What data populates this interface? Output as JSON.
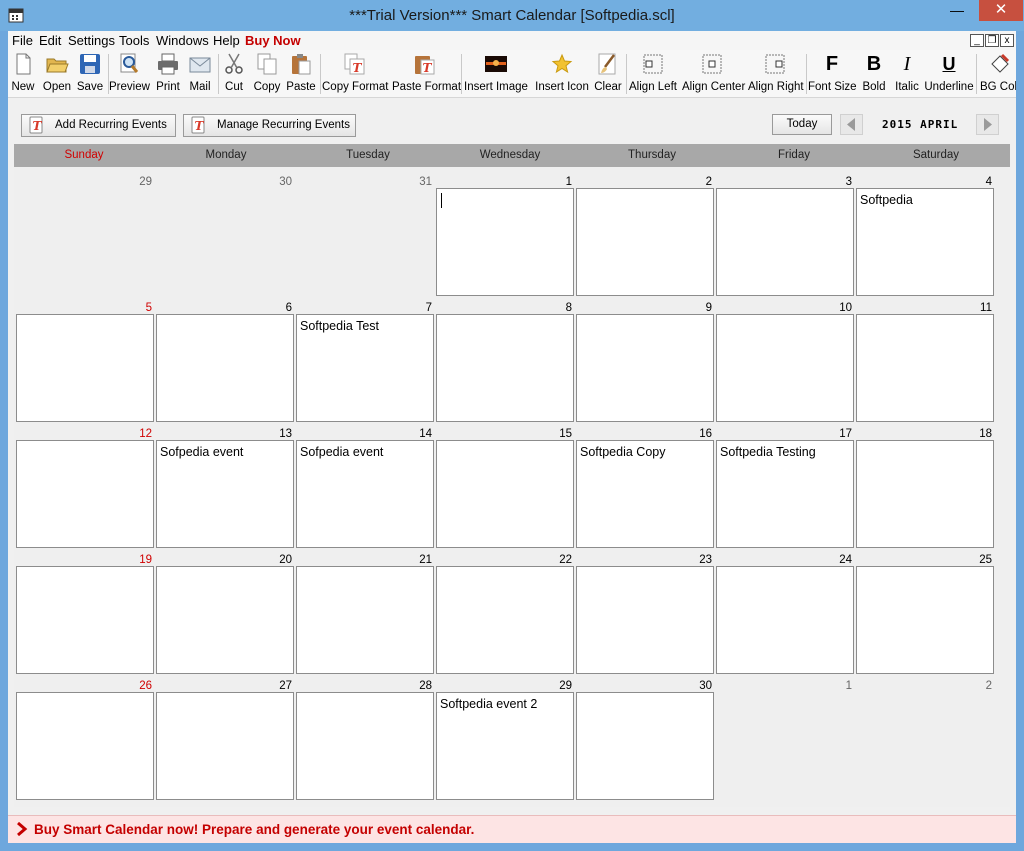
{
  "window": {
    "title": "***Trial Version*** Smart Calendar [Softpedia.scl]",
    "minimize_glyph": "—",
    "maximize_glyph": "☐",
    "close_glyph": "✕"
  },
  "menu": {
    "items": [
      "File",
      "Edit",
      "Settings",
      "Tools",
      "Windows",
      "Help",
      "Buy Now"
    ],
    "mdi_minimize": "_",
    "mdi_restore": "❐",
    "mdi_close": "x"
  },
  "toolbar": {
    "buttons": [
      {
        "label": "New",
        "icon": "new-file-icon"
      },
      {
        "label": "Open",
        "icon": "open-folder-icon"
      },
      {
        "label": "Save",
        "icon": "save-disk-icon"
      },
      {
        "label": "Preview",
        "icon": "preview-magnifier-icon"
      },
      {
        "label": "Print",
        "icon": "printer-icon"
      },
      {
        "label": "Mail",
        "icon": "mail-icon"
      },
      {
        "label": "Cut",
        "icon": "scissors-icon"
      },
      {
        "label": "Copy",
        "icon": "copy-icon"
      },
      {
        "label": "Paste",
        "icon": "paste-clipboard-icon"
      },
      {
        "label": "Copy Format",
        "icon": "copy-format-icon"
      },
      {
        "label": "Paste Format",
        "icon": "paste-format-icon"
      },
      {
        "label": "Insert Image",
        "icon": "insert-image-icon"
      },
      {
        "label": "Insert Icon",
        "icon": "insert-icon-star-icon"
      },
      {
        "label": "Clear",
        "icon": "clear-brush-icon"
      },
      {
        "label": "Align Left",
        "icon": "align-left-icon"
      },
      {
        "label": "Align Center",
        "icon": "align-center-icon"
      },
      {
        "label": "Align Right",
        "icon": "align-right-icon"
      },
      {
        "label": "Font Size",
        "icon": "font-size-icon"
      },
      {
        "label": "Bold",
        "icon": "bold-icon"
      },
      {
        "label": "Italic",
        "icon": "italic-icon"
      },
      {
        "label": "Underline",
        "icon": "underline-icon"
      },
      {
        "label": "BG Colo",
        "icon": "bg-color-bucket-icon"
      }
    ],
    "glyphs": {
      "font_size": "F",
      "bold": "B",
      "italic": "I",
      "underline": "U"
    }
  },
  "actions": {
    "add_recurring": "Add Recurring Events",
    "manage_recurring": "Manage Recurring Events",
    "today": "Today",
    "month_label": "2015 APRIL"
  },
  "weekdays": [
    "Sunday",
    "Monday",
    "Tuesday",
    "Wednesday",
    "Thursday",
    "Friday",
    "Saturday"
  ],
  "calendar": {
    "weeks": [
      [
        {
          "day": "29",
          "current": false,
          "text": ""
        },
        {
          "day": "30",
          "current": false,
          "text": ""
        },
        {
          "day": "31",
          "current": false,
          "text": ""
        },
        {
          "day": "1",
          "current": true,
          "text": "",
          "caret": true
        },
        {
          "day": "2",
          "current": true,
          "text": ""
        },
        {
          "day": "3",
          "current": true,
          "text": ""
        },
        {
          "day": "4",
          "current": true,
          "text": "Softpedia"
        }
      ],
      [
        {
          "day": "5",
          "current": true,
          "text": ""
        },
        {
          "day": "6",
          "current": true,
          "text": ""
        },
        {
          "day": "7",
          "current": true,
          "text": "Softpedia Test"
        },
        {
          "day": "8",
          "current": true,
          "text": ""
        },
        {
          "day": "9",
          "current": true,
          "text": ""
        },
        {
          "day": "10",
          "current": true,
          "text": ""
        },
        {
          "day": "11",
          "current": true,
          "text": ""
        }
      ],
      [
        {
          "day": "12",
          "current": true,
          "text": ""
        },
        {
          "day": "13",
          "current": true,
          "text": "Sofpedia event"
        },
        {
          "day": "14",
          "current": true,
          "text": "Sofpedia event"
        },
        {
          "day": "15",
          "current": true,
          "text": ""
        },
        {
          "day": "16",
          "current": true,
          "text": "Softpedia Copy"
        },
        {
          "day": "17",
          "current": true,
          "text": "Softpedia Testing"
        },
        {
          "day": "18",
          "current": true,
          "text": ""
        }
      ],
      [
        {
          "day": "19",
          "current": true,
          "text": ""
        },
        {
          "day": "20",
          "current": true,
          "text": ""
        },
        {
          "day": "21",
          "current": true,
          "text": ""
        },
        {
          "day": "22",
          "current": true,
          "text": ""
        },
        {
          "day": "23",
          "current": true,
          "text": ""
        },
        {
          "day": "24",
          "current": true,
          "text": ""
        },
        {
          "day": "25",
          "current": true,
          "text": ""
        }
      ],
      [
        {
          "day": "26",
          "current": true,
          "text": ""
        },
        {
          "day": "27",
          "current": true,
          "text": ""
        },
        {
          "day": "28",
          "current": true,
          "text": ""
        },
        {
          "day": "29",
          "current": true,
          "text": "Softpedia event 2"
        },
        {
          "day": "30",
          "current": true,
          "text": ""
        },
        {
          "day": "1",
          "current": false,
          "text": ""
        },
        {
          "day": "2",
          "current": false,
          "text": ""
        }
      ]
    ]
  },
  "footer": {
    "message": "Buy Smart Calendar now! Prepare and generate your event calendar."
  },
  "colors": {
    "sunday_red": "#d00000",
    "buy_now": "#c40000",
    "titlebar": "#72aee0",
    "close_button": "#c7503f",
    "footer_bg": "#fde4e4"
  }
}
